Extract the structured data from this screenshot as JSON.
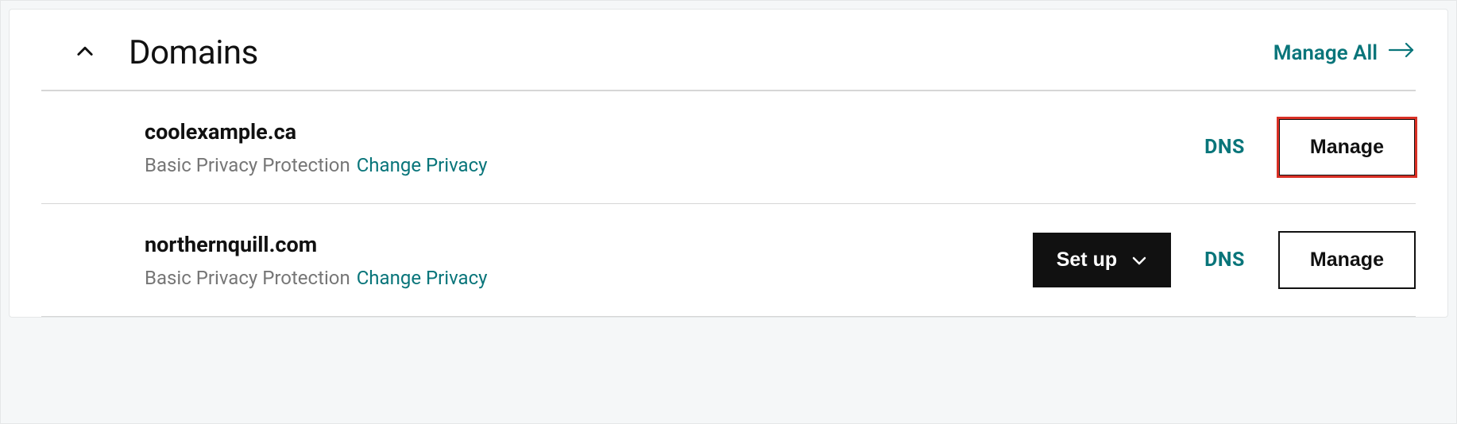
{
  "section": {
    "title": "Domains",
    "manage_all_label": "Manage All"
  },
  "domains": [
    {
      "name": "coolexample.ca",
      "privacy_status": "Basic Privacy Protection",
      "change_privacy_label": "Change Privacy",
      "show_setup": false,
      "setup_label": "Set up",
      "dns_label": "DNS",
      "manage_label": "Manage",
      "highlight_manage": true
    },
    {
      "name": "northernquill.com",
      "privacy_status": "Basic Privacy Protection",
      "change_privacy_label": "Change Privacy",
      "show_setup": true,
      "setup_label": "Set up",
      "dns_label": "DNS",
      "manage_label": "Manage",
      "highlight_manage": false
    }
  ]
}
